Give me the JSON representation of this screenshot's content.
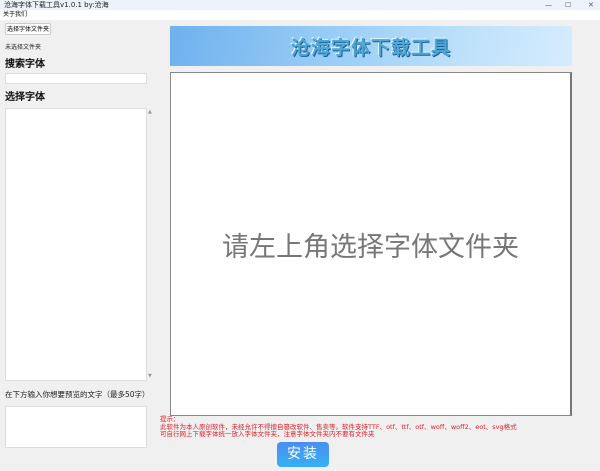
{
  "window": {
    "title": "沧海字体下载工具v1.0.1 by:沧海",
    "icon": "app-icon",
    "minimize": "—",
    "maximize": "☐",
    "close": "✕"
  },
  "menu": {
    "about": "关于我们"
  },
  "sidebar": {
    "choose_folder_button": "选择字体文件夹",
    "folder_status": "未选择文件夹",
    "search_heading": "搜索字体",
    "search_value": "",
    "select_heading": "选择字体",
    "preview_label": "在下方输入你想要预览的文字（最多50字）",
    "preview_text_value": ""
  },
  "banner": {
    "title": "沧海字体下载工具"
  },
  "preview": {
    "placeholder": "请左上角选择字体文件夹"
  },
  "notice": {
    "title": "提示：",
    "line1": "此软件为本人原创软件，未经允许不得擅自篡改软件、售卖等。软件支持TTF、otf、ttf、otf、woff、woff2、eot、svg格式",
    "line2": "可自行网上下载字体统一放入字体文件夹，注意字体文件夹内不要有文件夹"
  },
  "install_button": "安装",
  "colors": {
    "notice": "#e0202a",
    "install": "#3a9cf2"
  }
}
